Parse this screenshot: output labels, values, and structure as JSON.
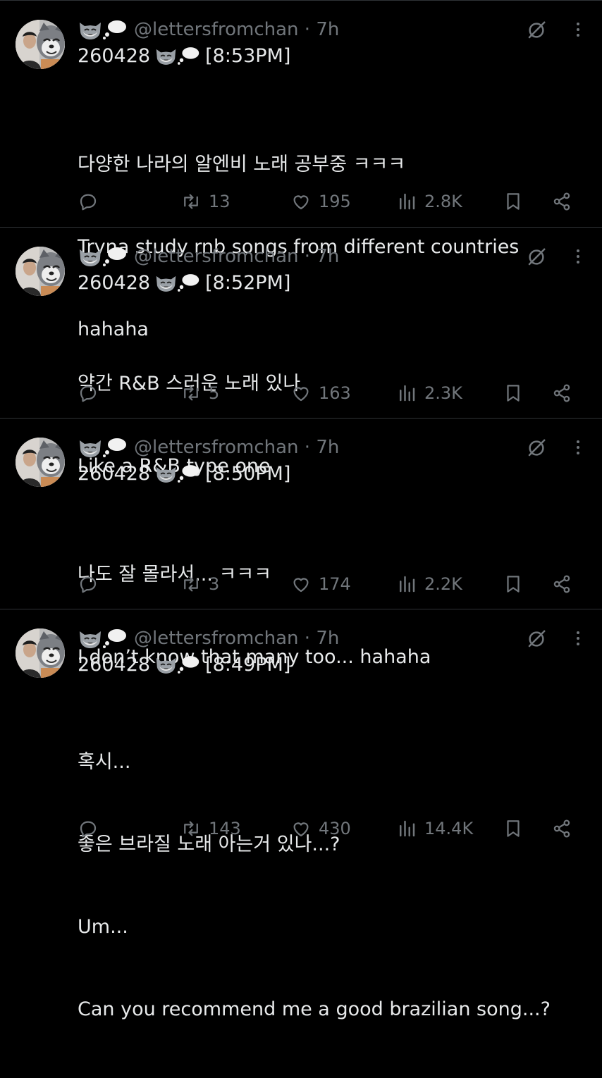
{
  "theme": {
    "background": "#000000",
    "text": "#e7e9ea",
    "muted": "#71767b",
    "separator": "#2f3336"
  },
  "tweets": [
    {
      "handle": "@lettersfromchan · 7h",
      "date": "260428",
      "time": "[8:53PM]",
      "lines": [
        "다양한 나라의 알엔비 노래 공부중 ㅋㅋㅋ",
        "Tryna study rnb songs from different countries",
        "hahaha"
      ],
      "retweets": "13",
      "likes": "195",
      "views": "2.8K"
    },
    {
      "handle": "@lettersfromchan · 7h",
      "date": "260428",
      "time": "[8:52PM]",
      "lines": [
        "약간 R&B 스러운 노래 있나",
        "Like a R&B type one"
      ],
      "retweets": "5",
      "likes": "163",
      "views": "2.3K"
    },
    {
      "handle": "@lettersfromchan · 7h",
      "date": "260428",
      "time": "[8:50PM]",
      "lines": [
        "나도 잘 몰라서... ㅋㅋㅋ",
        "I don’t know that many too... hahaha"
      ],
      "retweets": "3",
      "likes": "174",
      "views": "2.2K"
    },
    {
      "handle": "@lettersfromchan · 7h",
      "date": "260428",
      "time": "[8:49PM]",
      "lines": [
        "혹시...",
        "좋은 브라질 노래 아는거 있나...?",
        "Um...",
        "Can you recommend me a good brazilian song...?"
      ],
      "retweets": "143",
      "likes": "430",
      "views": "14.4K"
    }
  ],
  "icons": {
    "reply": "reply-icon",
    "retweet": "retweet-icon",
    "like": "heart-icon",
    "views": "views-icon",
    "bookmark": "bookmark-icon",
    "share": "share-icon",
    "grok": "grok-icon",
    "more": "more-icon",
    "emoji": "wolf-thought-emoji"
  }
}
